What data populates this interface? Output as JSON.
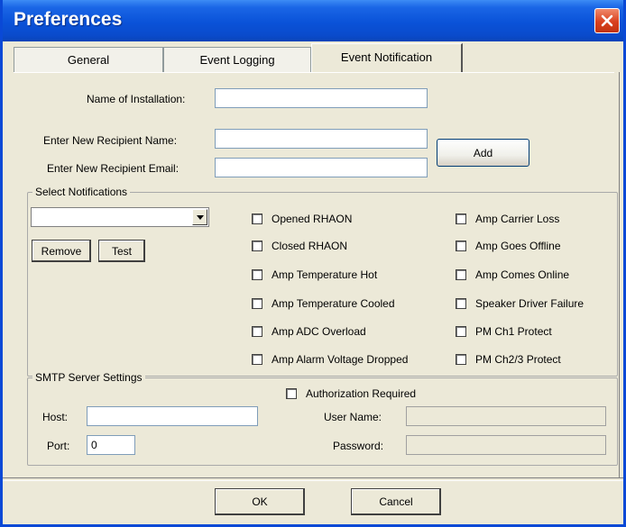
{
  "window": {
    "title": "Preferences"
  },
  "tabs": [
    {
      "label": "General"
    },
    {
      "label": "Event Logging"
    },
    {
      "label": "Event Notification"
    }
  ],
  "installation": {
    "label": "Name of Installation:",
    "value": ""
  },
  "recipient": {
    "name_label": "Enter New Recipient Name:",
    "name_value": "",
    "email_label": "Enter New Recipient Email:",
    "email_value": "",
    "add_label": "Add"
  },
  "notifications": {
    "group_title": "Select Notifications",
    "recipient_select_value": "",
    "remove_label": "Remove",
    "test_label": "Test",
    "left_column": [
      {
        "label": "Opened RHAON",
        "checked": false
      },
      {
        "label": "Closed RHAON",
        "checked": false
      },
      {
        "label": "Amp Temperature Hot",
        "checked": false
      },
      {
        "label": "Amp Temperature Cooled",
        "checked": false
      },
      {
        "label": "Amp ADC Overload",
        "checked": false
      },
      {
        "label": "Amp Alarm Voltage Dropped",
        "checked": false
      }
    ],
    "right_column": [
      {
        "label": "Amp Carrier Loss",
        "checked": false
      },
      {
        "label": "Amp Goes Offline",
        "checked": false
      },
      {
        "label": "Amp Comes Online",
        "checked": false
      },
      {
        "label": "Speaker Driver Failure",
        "checked": false
      },
      {
        "label": "PM Ch1 Protect",
        "checked": false
      },
      {
        "label": "PM Ch2/3 Protect",
        "checked": false
      }
    ]
  },
  "smtp": {
    "group_title": "SMTP Server Settings",
    "host_label": "Host:",
    "host_value": "",
    "port_label": "Port:",
    "port_value": "0",
    "auth_label": "Authorization Required",
    "auth_checked": false,
    "username_label": "User Name:",
    "username_value": "",
    "password_label": "Password:",
    "password_value": ""
  },
  "footer": {
    "ok_label": "OK",
    "cancel_label": "Cancel"
  },
  "colors": {
    "titlebar": "#0a52d8",
    "dialog_bg": "#ece9d8",
    "close_button": "#d9411f"
  }
}
